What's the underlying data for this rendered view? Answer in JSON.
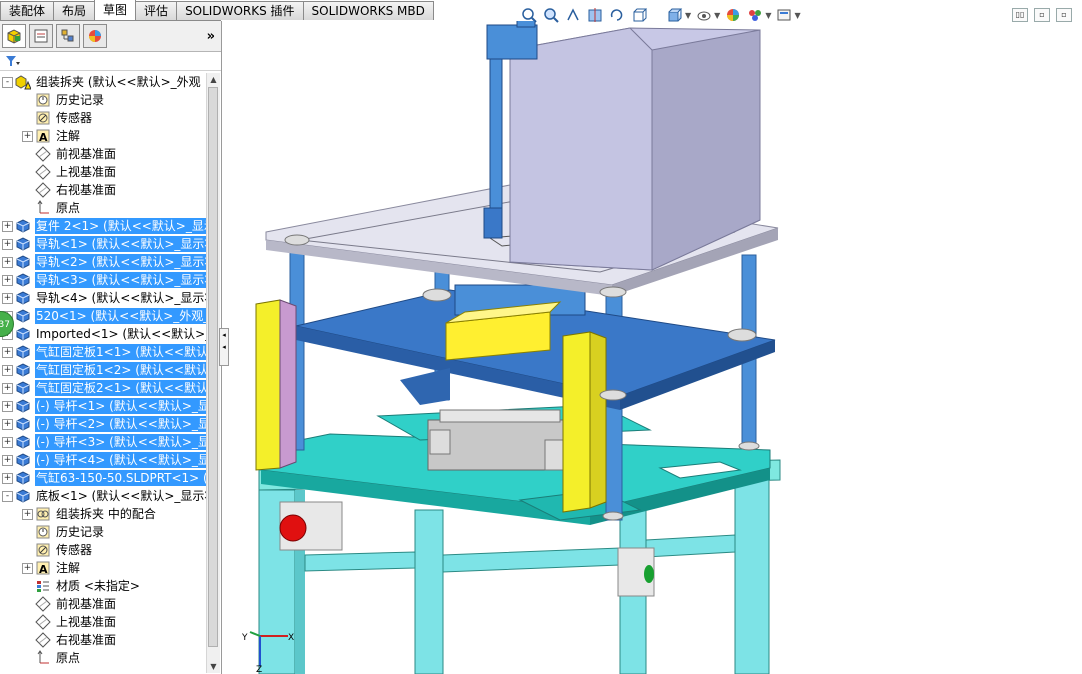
{
  "tabs": [
    "装配体",
    "布局",
    "草图",
    "评估",
    "SOLIDWORKS 插件",
    "SOLIDWORKS MBD"
  ],
  "active_tab": 2,
  "hud_icons": [
    "zoom-to-fit-icon",
    "zoom-area-icon",
    "previous-view-icon",
    "section-view-icon",
    "dynamic-annotation-icon",
    "view-orientation-icon",
    "display-style-icon",
    "hide-show-icon",
    "edit-appearance-icon",
    "apply-scene-icon",
    "view-settings-icon"
  ],
  "panel": {
    "tab_icons": [
      "feature-manager-icon",
      "property-manager-icon",
      "configuration-manager-icon",
      "display-manager-icon"
    ],
    "expand_label": "»",
    "filter_icon": "filter-icon",
    "badge": "37"
  },
  "tree": [
    {
      "label": "组装拆夹  (默认<<默认>_外观",
      "level": 0,
      "exp": "-",
      "icon": "assembly-warning-icon",
      "sel": false
    },
    {
      "label": "历史记录",
      "level": 1,
      "exp": "",
      "icon": "history-icon",
      "sel": false
    },
    {
      "label": "传感器",
      "level": 1,
      "exp": "",
      "icon": "sensor-icon",
      "sel": false
    },
    {
      "label": "注解",
      "level": 1,
      "exp": "+",
      "icon": "annotation-icon",
      "sel": false
    },
    {
      "label": "前视基准面",
      "level": 1,
      "exp": "",
      "icon": "plane-icon",
      "sel": false
    },
    {
      "label": "上视基准面",
      "level": 1,
      "exp": "",
      "icon": "plane-icon",
      "sel": false
    },
    {
      "label": "右视基准面",
      "level": 1,
      "exp": "",
      "icon": "plane-icon",
      "sel": false
    },
    {
      "label": "原点",
      "level": 1,
      "exp": "",
      "icon": "origin-icon",
      "sel": false
    },
    {
      "label": "复件 2<1> (默认<<默认>_显示状",
      "level": 0,
      "exp": "+",
      "icon": "part-icon",
      "sel": true
    },
    {
      "label": "导轨<1> (默认<<默认>_显示状",
      "level": 0,
      "exp": "+",
      "icon": "part-icon",
      "sel": true
    },
    {
      "label": "导轨<2> (默认<<默认>_显示状",
      "level": 0,
      "exp": "+",
      "icon": "part-icon",
      "sel": true
    },
    {
      "label": "导轨<3> (默认<<默认>_显示状",
      "level": 0,
      "exp": "+",
      "icon": "part-icon",
      "sel": true
    },
    {
      "label": "导轨<4> (默认<<默认>_显示状",
      "level": 0,
      "exp": "+",
      "icon": "part-icon",
      "sel": false
    },
    {
      "label": "520<1> (默认<<默认>_外观_显",
      "level": 0,
      "exp": "+",
      "icon": "part-icon",
      "sel": true
    },
    {
      "label": "Imported<1> (默认<<默认>_",
      "level": 0,
      "exp": "+",
      "icon": "part-icon",
      "sel": false
    },
    {
      "label": "气缸固定板1<1> (默认<<默认",
      "level": 0,
      "exp": "+",
      "icon": "part-icon",
      "sel": true
    },
    {
      "label": "气缸固定板1<2> (默认<<默认",
      "level": 0,
      "exp": "+",
      "icon": "part-icon",
      "sel": true
    },
    {
      "label": "气缸固定板2<1> (默认<<默认",
      "level": 0,
      "exp": "+",
      "icon": "part-icon",
      "sel": true
    },
    {
      "label": "(-) 导杆<1> (默认<<默认>_显",
      "level": 0,
      "exp": "+",
      "icon": "part-icon",
      "sel": true
    },
    {
      "label": "(-) 导杆<2> (默认<<默认>_显",
      "level": 0,
      "exp": "+",
      "icon": "part-icon",
      "sel": true
    },
    {
      "label": "(-) 导杆<3> (默认<<默认>_显",
      "level": 0,
      "exp": "+",
      "icon": "part-icon",
      "sel": true
    },
    {
      "label": "(-) 导杆<4> (默认<<默认>_显",
      "level": 0,
      "exp": "+",
      "icon": "part-icon",
      "sel": true
    },
    {
      "label": "气缸63-150-50.SLDPRT<1> (默",
      "level": 0,
      "exp": "+",
      "icon": "part-icon",
      "sel": true
    },
    {
      "label": "底板<1> (默认<<默认>_显示状",
      "level": 0,
      "exp": "-",
      "icon": "part-icon",
      "sel": false
    },
    {
      "label": "组装拆夹 中的配合",
      "level": 1,
      "exp": "+",
      "icon": "mates-icon",
      "sel": false
    },
    {
      "label": "历史记录",
      "level": 1,
      "exp": "",
      "icon": "history-icon",
      "sel": false
    },
    {
      "label": "传感器",
      "level": 1,
      "exp": "",
      "icon": "sensor-icon",
      "sel": false
    },
    {
      "label": "注解",
      "level": 1,
      "exp": "+",
      "icon": "annotation-icon",
      "sel": false
    },
    {
      "label": "材质 <未指定>",
      "level": 1,
      "exp": "",
      "icon": "material-icon",
      "sel": false
    },
    {
      "label": "前视基准面",
      "level": 1,
      "exp": "",
      "icon": "plane-icon",
      "sel": false
    },
    {
      "label": "上视基准面",
      "level": 1,
      "exp": "",
      "icon": "plane-icon",
      "sel": false
    },
    {
      "label": "右视基准面",
      "level": 1,
      "exp": "",
      "icon": "plane-icon",
      "sel": false
    },
    {
      "label": "原点",
      "level": 1,
      "exp": "",
      "icon": "origin-icon",
      "sel": false
    }
  ],
  "triad": {
    "x": "X",
    "y": "Y",
    "z": "Z"
  }
}
